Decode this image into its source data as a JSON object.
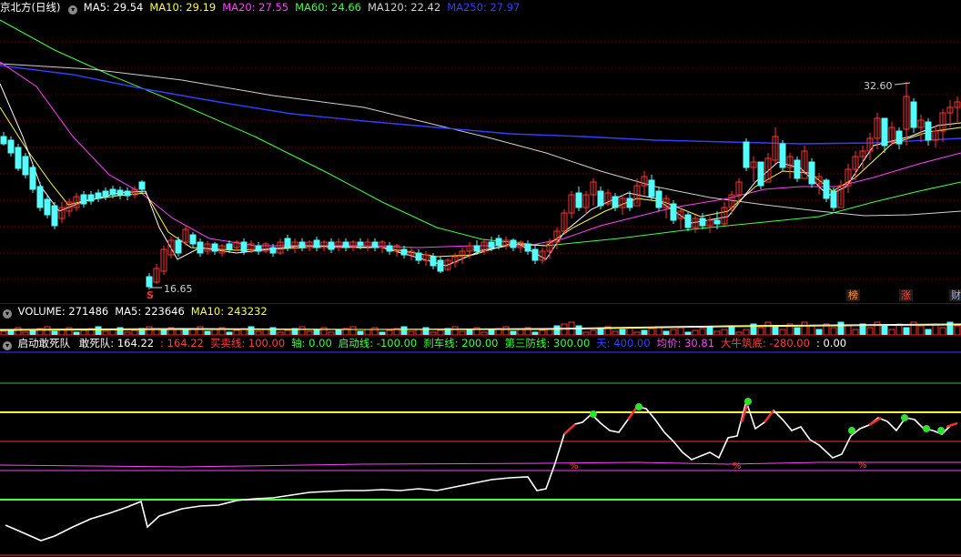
{
  "main": {
    "title": "京北方(日线)",
    "ma": [
      {
        "label": "MA5: 29.54",
        "color": "#ffffff"
      },
      {
        "label": "MA10: 29.19",
        "color": "#ffff40"
      },
      {
        "label": "MA20: 27.55",
        "color": "#ff40ff"
      },
      {
        "label": "MA60: 24.66",
        "color": "#40ff40"
      },
      {
        "label": "MA120: 22.42",
        "color": "#d0d0d0"
      },
      {
        "label": "MA250: 27.97",
        "color": "#3040ff"
      }
    ],
    "high_label": "32.60",
    "low_label": "16.65",
    "signal_label": "S",
    "tags": [
      {
        "name": "tag-bang",
        "text": "榜",
        "color": "#ff9a40"
      },
      {
        "name": "tag-zhang",
        "text": "涨",
        "color": "#ff4040"
      },
      {
        "name": "tag-cai",
        "text": "财",
        "color": "#80c0ff"
      }
    ]
  },
  "volume": {
    "items": [
      {
        "label": "VOLUME: 271486",
        "color": "#ffffff"
      },
      {
        "label": "MA5: 223646",
        "color": "#ffffff"
      },
      {
        "label": "MA10: 243232",
        "color": "#ffff40"
      }
    ]
  },
  "indicator": {
    "name": "启动敢死队",
    "items": [
      {
        "label": "敢死队: 164.22",
        "color": "#ffffff"
      },
      {
        "label": ": 164.22",
        "color": "#ff4040"
      },
      {
        "label": "买卖线: 100.00",
        "color": "#ff4040"
      },
      {
        "label": "轴: 0.00",
        "color": "#40ff40"
      },
      {
        "label": "启动线: -100.00",
        "color": "#40ff40"
      },
      {
        "label": "刹车线: 200.00",
        "color": "#40ff40"
      },
      {
        "label": "第三防线: 300.00",
        "color": "#40ff40"
      },
      {
        "label": "天: 400.00",
        "color": "#3040ff"
      },
      {
        "label": "均价: 30.81",
        "color": "#ff40ff"
      },
      {
        "label": "大牛筑底: -280.00",
        "color": "#ff4040"
      },
      {
        "label": ": 0.00",
        "color": "#ffffff"
      }
    ],
    "pct_mark": "%"
  },
  "colors": {
    "up": "#ff3232",
    "down": "#54fcfc",
    "grid": "#7a0000"
  }
}
